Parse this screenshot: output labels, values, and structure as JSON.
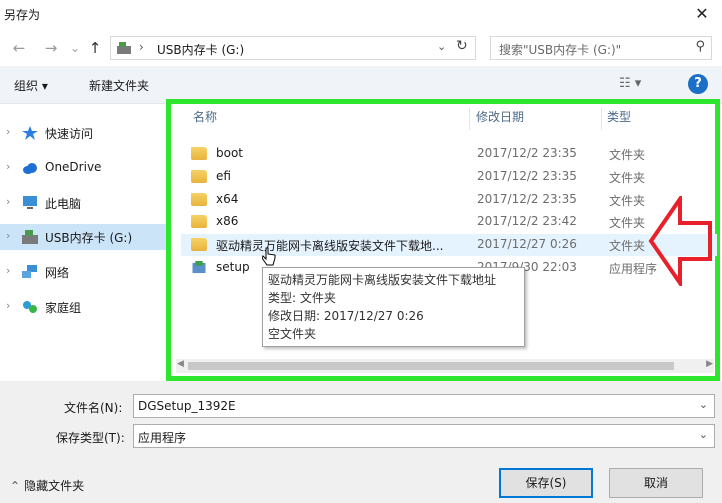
{
  "window": {
    "title": "另存为",
    "close": "✕"
  },
  "nav": {
    "back": "←",
    "forward": "→",
    "recent": "⌄",
    "up": "↑"
  },
  "address": {
    "separator": "›",
    "path": "USB内存卡 (G:)",
    "dropdown": "⌄",
    "refresh": "↻"
  },
  "search": {
    "placeholder": "搜索\"USB内存卡 (G:)\"",
    "icon": "⚲"
  },
  "toolbar": {
    "organize": "组织 ▾",
    "new_folder": "新建文件夹",
    "view": "☷ ▾",
    "help": "?"
  },
  "sidebar": {
    "items": [
      {
        "label": "快速访问",
        "icon": "star-icon",
        "color": "#2a7de1"
      },
      {
        "label": "OneDrive",
        "icon": "cloud-icon",
        "color": "#1f6fd6"
      },
      {
        "label": "此电脑",
        "icon": "computer-icon",
        "color": "#3b8fd6"
      },
      {
        "label": "USB内存卡 (G:)",
        "icon": "drive-icon",
        "color": "#4a9a4a"
      },
      {
        "label": "网络",
        "icon": "network-icon",
        "color": "#3b8fd6"
      },
      {
        "label": "家庭组",
        "icon": "homegroup-icon",
        "color": "#2a9fd6"
      }
    ],
    "chevron": "›"
  },
  "columns": {
    "name": "名称",
    "date": "修改日期",
    "type": "类型"
  },
  "files": [
    {
      "name": "boot",
      "date": "2017/12/2 23:35",
      "type": "文件夹",
      "icon": "folder-icon"
    },
    {
      "name": "efi",
      "date": "2017/12/2 23:35",
      "type": "文件夹",
      "icon": "folder-icon"
    },
    {
      "name": "x64",
      "date": "2017/12/2 23:35",
      "type": "文件夹",
      "icon": "folder-icon"
    },
    {
      "name": "x86",
      "date": "2017/12/2 23:42",
      "type": "文件夹",
      "icon": "folder-icon"
    },
    {
      "name": "驱动精灵万能网卡离线版安装文件下载地...",
      "date": "2017/12/27 0:26",
      "type": "文件夹",
      "icon": "folder-icon"
    },
    {
      "name": "setup",
      "date": "2017/9/30 22:03",
      "type": "应用程序",
      "icon": "setup-icon"
    }
  ],
  "tooltip": {
    "line1": "驱动精灵万能网卡离线版安装文件下载地址",
    "line2": "类型: 文件夹",
    "line3": "修改日期: 2017/12/27 0:26",
    "line4": "空文件夹"
  },
  "form": {
    "filename_label": "文件名(N):",
    "filename_value": "DGSetup_1392E",
    "filetype_label": "保存类型(T):",
    "filetype_value": "应用程序",
    "dropdown": "⌄"
  },
  "footer": {
    "hide_folders": "隐藏文件夹",
    "hide_caret": "⌃",
    "save": "保存(S)",
    "cancel": "取消"
  },
  "colors": {
    "highlight_border": "#2ee62e",
    "arrow": "#e8202a",
    "selected": "#cce4f7",
    "accent": "#0078d7"
  }
}
